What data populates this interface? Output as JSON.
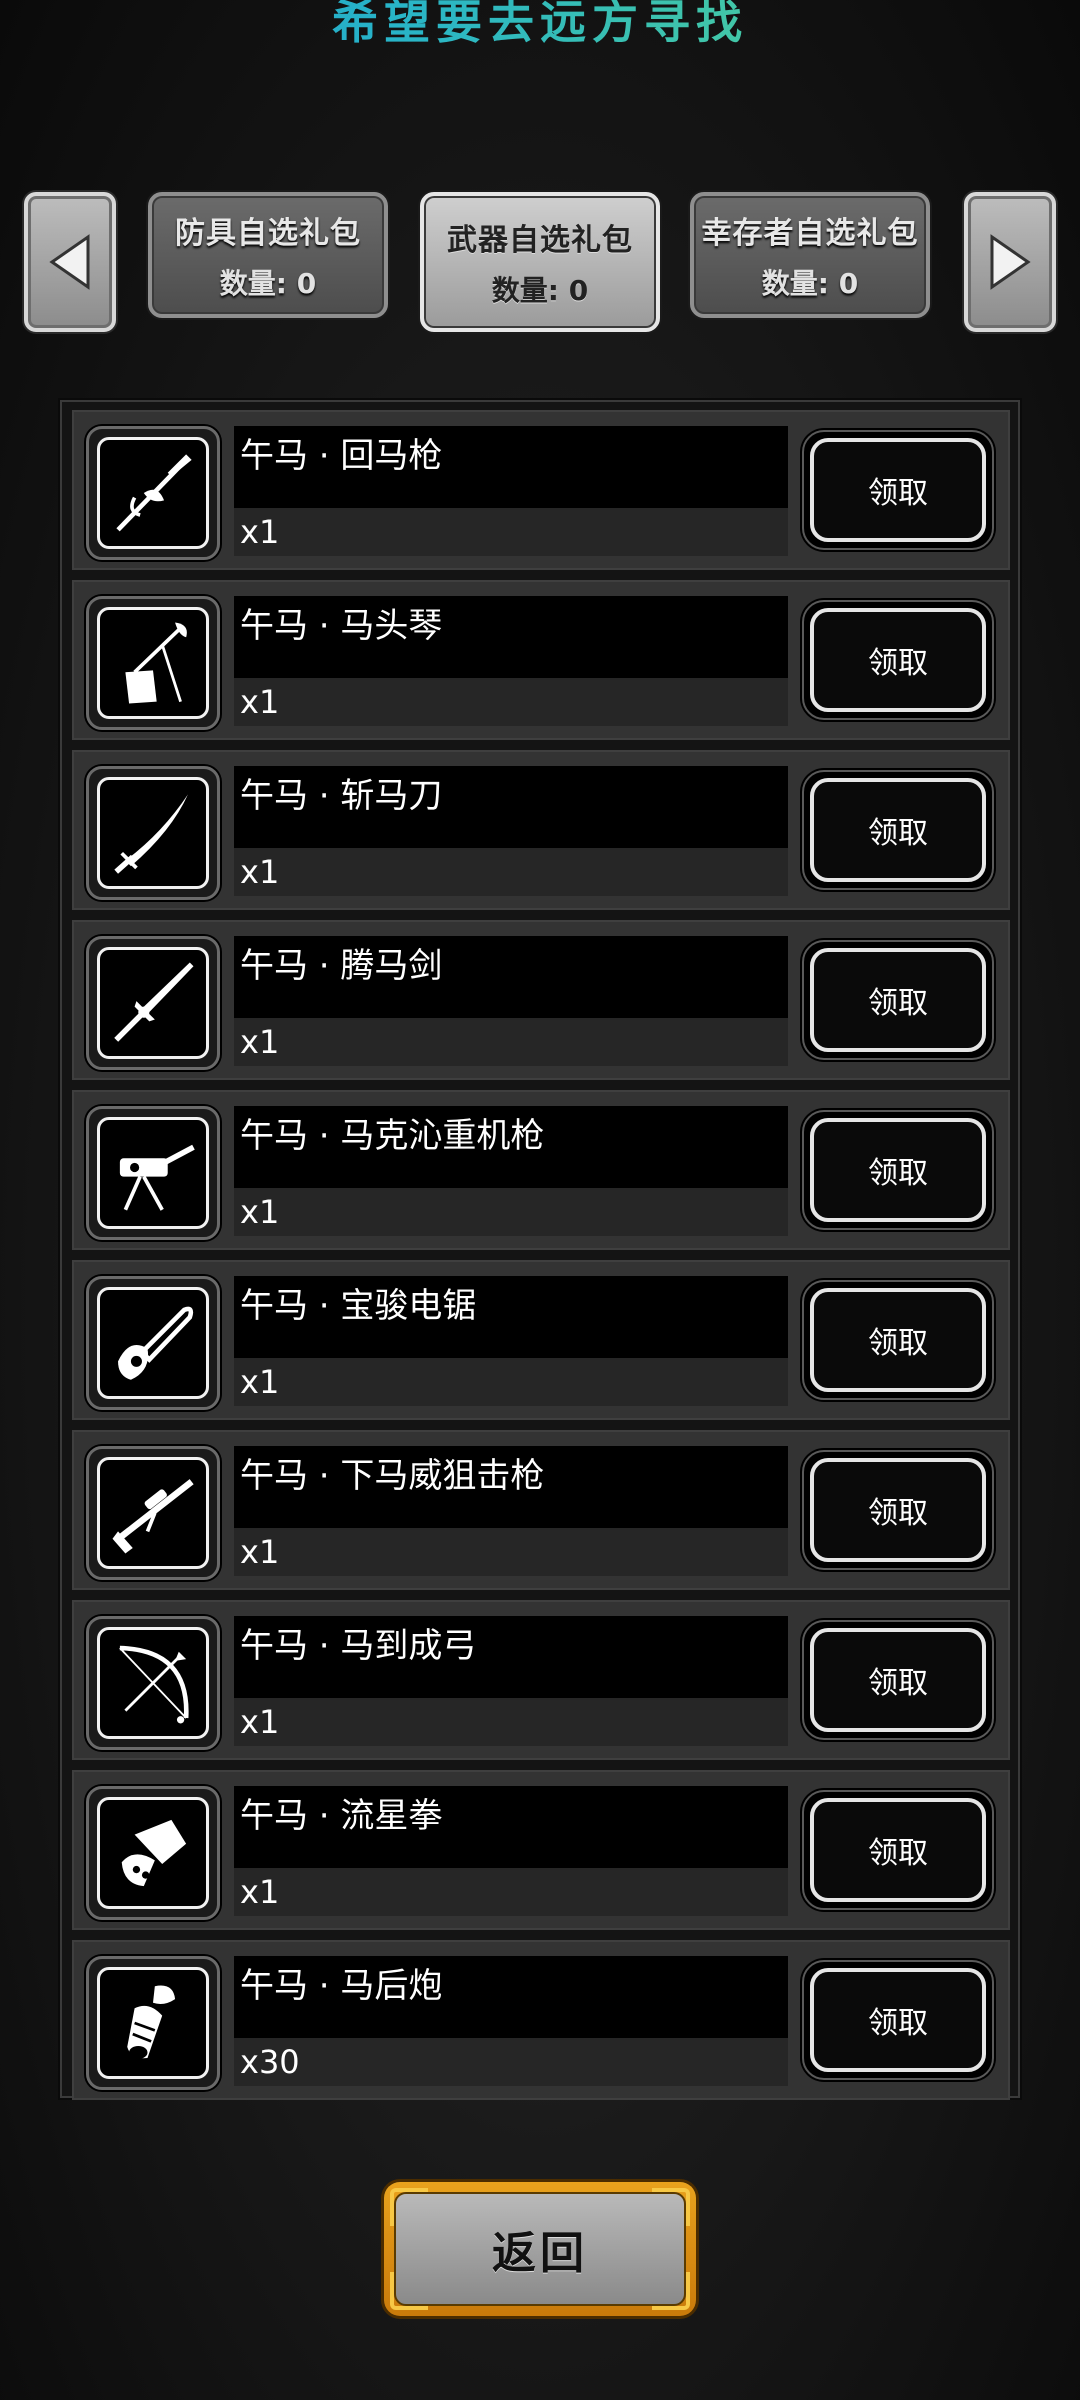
{
  "banner_title": "希望要去远方寻找",
  "tabs": [
    {
      "name": "防具自选礼包",
      "count_label": "数量:",
      "count_value": "0",
      "active": false
    },
    {
      "name": "武器自选礼包",
      "count_label": "数量:",
      "count_value": "0",
      "active": true
    },
    {
      "name": "幸存者自选礼包",
      "count_label": "数量:",
      "count_value": "0",
      "active": false
    }
  ],
  "arrows": {
    "left": "left-arrow-icon",
    "right": "right-arrow-icon"
  },
  "items": [
    {
      "name": "午马 · 回马枪",
      "qty": "x1",
      "icon": "spear-icon",
      "claim_label": "领取"
    },
    {
      "name": "午马 · 马头琴",
      "qty": "x1",
      "icon": "horsehead-fiddle-icon",
      "claim_label": "领取"
    },
    {
      "name": "午马 · 斩马刀",
      "qty": "x1",
      "icon": "saber-icon",
      "claim_label": "领取"
    },
    {
      "name": "午马 · 腾马剑",
      "qty": "x1",
      "icon": "sword-icon",
      "claim_label": "领取"
    },
    {
      "name": "午马 · 马克沁重机枪",
      "qty": "x1",
      "icon": "heavy-machine-gun-icon",
      "claim_label": "领取"
    },
    {
      "name": "午马 · 宝骏电锯",
      "qty": "x1",
      "icon": "chainsaw-icon",
      "claim_label": "领取"
    },
    {
      "name": "午马 · 下马威狙击枪",
      "qty": "x1",
      "icon": "sniper-rifle-icon",
      "claim_label": "领取"
    },
    {
      "name": "午马 · 马到成弓",
      "qty": "x1",
      "icon": "bow-icon",
      "claim_label": "领取"
    },
    {
      "name": "午马 · 流星拳",
      "qty": "x1",
      "icon": "gauntlet-icon",
      "claim_label": "领取"
    },
    {
      "name": "午马 · 马后炮",
      "qty": "x30",
      "icon": "cannon-icon",
      "claim_label": "领取"
    }
  ],
  "back_label": "返回",
  "colors": {
    "title_start": "#1f8fb8",
    "title_end": "#62c98f",
    "back_frame": "#e9a21d"
  }
}
